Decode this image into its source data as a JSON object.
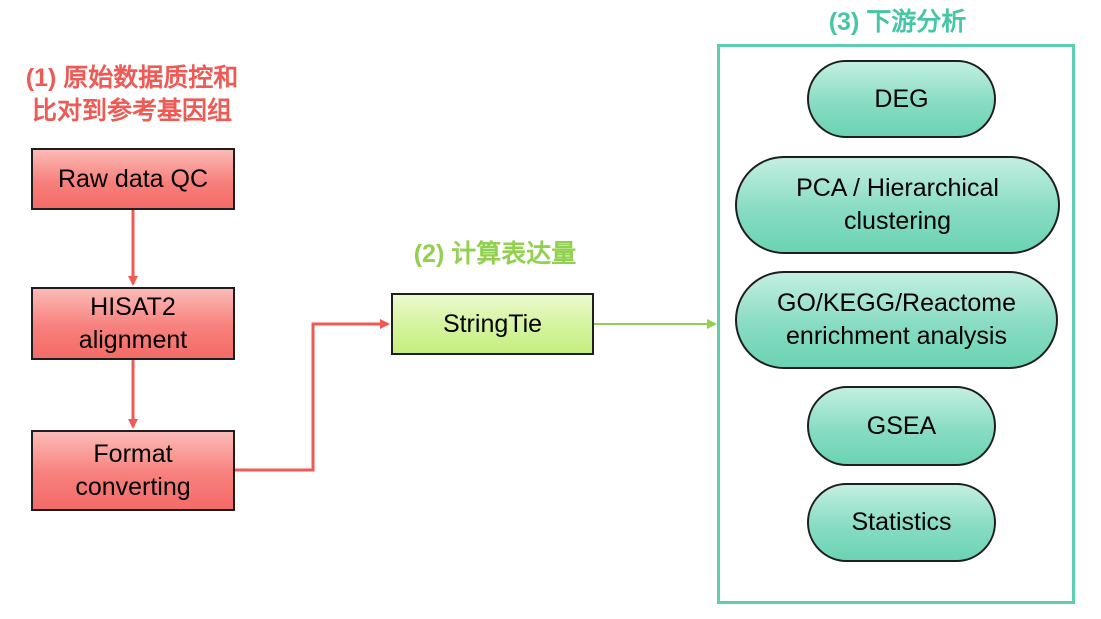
{
  "sections": {
    "qc": {
      "number": "(1)",
      "title_lines": [
        "原始数据质控和",
        "比对到参考基因组"
      ],
      "color": "#f05a55"
    },
    "quant": {
      "number": "(2)",
      "title": "计算表达量",
      "color": "#92d050"
    },
    "downstream": {
      "number": "(3)",
      "title": "下游分析",
      "color": "#46c6a4"
    }
  },
  "nodes": {
    "raw_qc": {
      "lines": [
        "Raw data QC"
      ]
    },
    "hisat2": {
      "lines": [
        "HISAT2",
        "alignment"
      ]
    },
    "format": {
      "lines": [
        "Format",
        "converting"
      ]
    },
    "stringtie": {
      "lines": [
        "StringTie"
      ]
    },
    "deg": {
      "lines": [
        "DEG"
      ]
    },
    "pca": {
      "lines": [
        "PCA / Hierarchical",
        "clustering"
      ]
    },
    "enrichment": {
      "lines": [
        "GO/KEGG/Reactome",
        "enrichment analysis"
      ]
    },
    "gsea": {
      "lines": [
        "GSEA"
      ]
    },
    "statistics": {
      "lines": [
        "Statistics"
      ]
    }
  },
  "edges": [
    {
      "from": "Raw data QC",
      "to": "HISAT2 alignment",
      "color": "#f05a55"
    },
    {
      "from": "HISAT2 alignment",
      "to": "Format converting",
      "color": "#f05a55"
    },
    {
      "from": "Format converting",
      "to": "StringTie",
      "color": "#f05a55"
    },
    {
      "from": "StringTie",
      "to": "下游分析",
      "color": "#92d050"
    }
  ]
}
